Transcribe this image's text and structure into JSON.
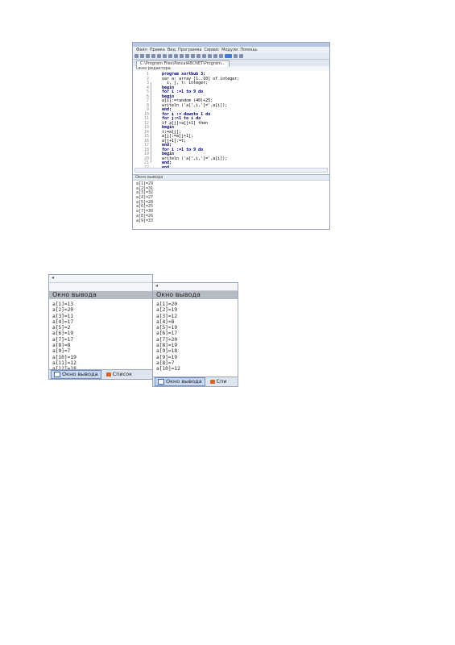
{
  "ide": {
    "menu": [
      "Файл",
      "Правка",
      "Вид",
      "Программа",
      "Сервис",
      "Модули",
      "Помощь"
    ],
    "tab_title": "C:\\Program Files\\PascalABCNET\\Program...",
    "pane_caption": "Окно редактора",
    "line_numbers": [
      "1",
      "2",
      "3",
      "4",
      "5",
      "6",
      "7",
      "8",
      "9",
      "10",
      "11",
      "12",
      "13",
      "14",
      "15",
      "16",
      "17",
      "18",
      "19",
      "20",
      "21",
      "22"
    ],
    "code": [
      "program sortbub 3;",
      "var a: array [1..10] of integer;",
      "  i, j, t: integer;",
      "begin",
      "for i :=1 to 9 do",
      "begin",
      "a[i]:=random (40)+25;",
      "writeln ('a[',i,']=',a[i]);",
      "end;",
      "for i := downto 1 do",
      "for j:=1 to i do",
      "if a[j]>a[j+1] then",
      "begin",
      "t:=a[j];",
      "a[j]:=a[j+1];",
      "a[j+1]:=t;",
      "end;",
      "for i :=1 to 9 do",
      "begin",
      "writeln ('a[',i,']=',a[i]);",
      "end;",
      "end."
    ],
    "output_caption": "Окно вывода",
    "output_lines": [
      "a[1]=29",
      "a[2]=31",
      "a[3]=32",
      "a[4]=27",
      "a[5]=28",
      "a[6]=25",
      "a[7]=30",
      "a[8]=26",
      "a[9]=33"
    ]
  },
  "window_a": {
    "header": "Окно вывода",
    "lines": [
      "a[1]=13",
      "a[2]=20",
      "a[3]=11",
      "a[4]=17",
      "a[5]=2",
      "a[6]=19",
      "a[7]=17",
      "a[8]=8",
      "a[9]=7",
      "a[10]=19",
      "a[11]=12",
      "a[12]=18"
    ],
    "tab_output": "Окно вывода",
    "tab_errors": "Список"
  },
  "window_b": {
    "header": "Окно вывода",
    "lines": [
      "a[1]=20",
      "a[2]=19",
      "a[3]=12",
      "a[4]=8",
      "a[5]=19",
      "a[6]=17",
      "a[7]=20",
      "a[8]=19",
      "a[9]=18",
      "a[9]=19",
      "a[8]=7",
      "a[10]=12"
    ],
    "tab_output": "Окно вывода",
    "tab_errors": "Спи"
  }
}
